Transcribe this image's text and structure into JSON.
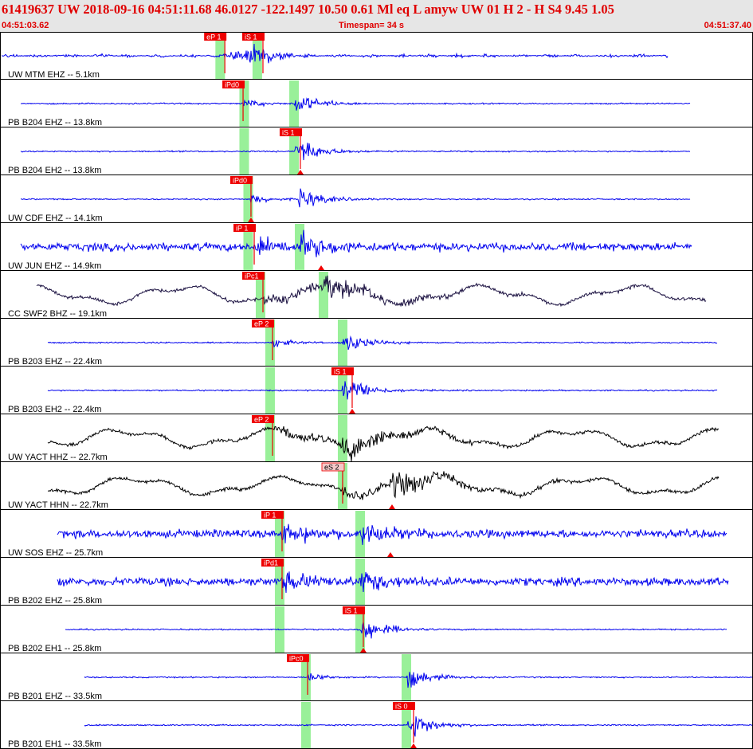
{
  "header": {
    "title": "61419637 UW 2018-09-16 04:51:11.68   46.0127 -122.1497  10.50  0.61 Ml  eq  L amyw     UW 01  H   2  -  H S4    9.45  1.05",
    "start_time": "04:51:03.62",
    "timespan": "Timespan=  34 s",
    "end_time": "04:51:37.40"
  },
  "colors": {
    "header_bg": "#e6e6e6",
    "header_text": "#e00000",
    "trace_blue": "#0000ee",
    "trace_navy": "#1a1040",
    "trace_black": "#000000",
    "pick_red": "#ee0000",
    "pick_weak": "#f4c8c8",
    "window_green": "#99f099"
  },
  "traces": [
    {
      "label": "UW MTM EHZ -- 5.1km",
      "color": "blue",
      "style": "small",
      "picks": [
        {
          "text": "eP 1",
          "t": 0.2986,
          "style": "red"
        },
        {
          "text": "iS 1",
          "t": 0.3492,
          "style": "red"
        }
      ],
      "windows": [
        0.2924,
        0.3417
      ],
      "marker_t": null
    },
    {
      "label": "PB B204 EHZ -- 13.8km",
      "color": "blue",
      "style": "event",
      "picks": [
        {
          "text": "iPd0",
          "t": 0.3228,
          "style": "red"
        }
      ],
      "windows": [
        0.3243,
        0.3905
      ],
      "marker_t": null
    },
    {
      "label": "PB B204 EH2 -- 13.8km",
      "color": "blue",
      "style": "event",
      "picks": [
        {
          "text": "iS 1",
          "t": 0.3989,
          "style": "red"
        }
      ],
      "windows": [
        0.3243,
        0.3905
      ],
      "marker_t": 0.3989
    },
    {
      "label": "UW CDF EHZ -- 14.1km",
      "color": "blue",
      "style": "event",
      "picks": [
        {
          "text": "iPd0",
          "t": 0.3333,
          "style": "red"
        }
      ],
      "windows": [
        0.3296
      ],
      "marker_t": 0.3333
    },
    {
      "label": "UW JUN EHZ -- 14.9km",
      "color": "blue",
      "style": "noisy",
      "picks": [
        {
          "text": "iP 1",
          "t": 0.3376,
          "style": "red"
        }
      ],
      "windows": [
        0.3296,
        0.3979
      ],
      "marker_t": 0.4265
    },
    {
      "label": "CC SWF2 BHZ -- 19.1km",
      "color": "navy",
      "style": "wavy",
      "picks": [
        {
          "text": "iPc1",
          "t": 0.3492,
          "style": "red"
        }
      ],
      "windows": [
        0.346,
        0.4296
      ],
      "marker_t": null
    },
    {
      "label": "PB B203 EHZ -- 22.4km",
      "color": "blue",
      "style": "event",
      "picks": [
        {
          "text": "eP 2",
          "t": 0.3619,
          "style": "red"
        }
      ],
      "windows": [
        0.3587,
        0.455
      ],
      "marker_t": null
    },
    {
      "label": "PB B203 EH2 -- 22.4km",
      "color": "blue",
      "style": "event",
      "picks": [
        {
          "text": "iS 1",
          "t": 0.4677,
          "style": "red"
        }
      ],
      "windows": [
        0.3587,
        0.455
      ],
      "marker_t": 0.4677
    },
    {
      "label": "UW YACT HHZ -- 22.7km",
      "color": "black",
      "style": "wavy",
      "picks": [
        {
          "text": "eP 2",
          "t": 0.3619,
          "style": "red"
        }
      ],
      "windows": [
        0.3587,
        0.455
      ],
      "marker_t": null
    },
    {
      "label": "UW YACT HHN -- 22.7km",
      "color": "black",
      "style": "wavy",
      "picks": [
        {
          "text": "eS 2",
          "t": 0.455,
          "style": "weak"
        }
      ],
      "windows": [
        0.455
      ],
      "marker_t": 0.5206
    },
    {
      "label": "UW SOS EHZ -- 25.7km",
      "color": "blue",
      "style": "noisy",
      "picks": [
        {
          "text": "iP 1",
          "t": 0.3746,
          "style": "red"
        }
      ],
      "windows": [
        0.3714,
        0.4783
      ],
      "marker_t": 0.5185
    },
    {
      "label": "PB B202 EHZ -- 25.8km",
      "color": "blue",
      "style": "noisy",
      "picks": [
        {
          "text": "iPd1",
          "t": 0.3746,
          "style": "red"
        }
      ],
      "windows": [
        0.3714,
        0.4783
      ],
      "marker_t": null
    },
    {
      "label": "PB B202 EH1 -- 25.8km",
      "color": "blue",
      "style": "event",
      "picks": [
        {
          "text": "iS 1",
          "t": 0.4825,
          "style": "red"
        }
      ],
      "windows": [
        0.3714,
        0.4783
      ],
      "marker_t": 0.4825
    },
    {
      "label": "PB B201 EHZ -- 33.5km",
      "color": "blue",
      "style": "event",
      "picks": [
        {
          "text": "iPc0",
          "t": 0.4085,
          "style": "red"
        }
      ],
      "windows": [
        0.4063,
        0.5397
      ],
      "marker_t": null
    },
    {
      "label": "PB B201 EH1 -- 33.5km",
      "color": "blue",
      "style": "event",
      "picks": [
        {
          "text": "iS 0",
          "t": 0.5492,
          "style": "red"
        }
      ],
      "windows": [
        0.4063,
        0.5397
      ],
      "marker_t": 0.5492
    }
  ]
}
